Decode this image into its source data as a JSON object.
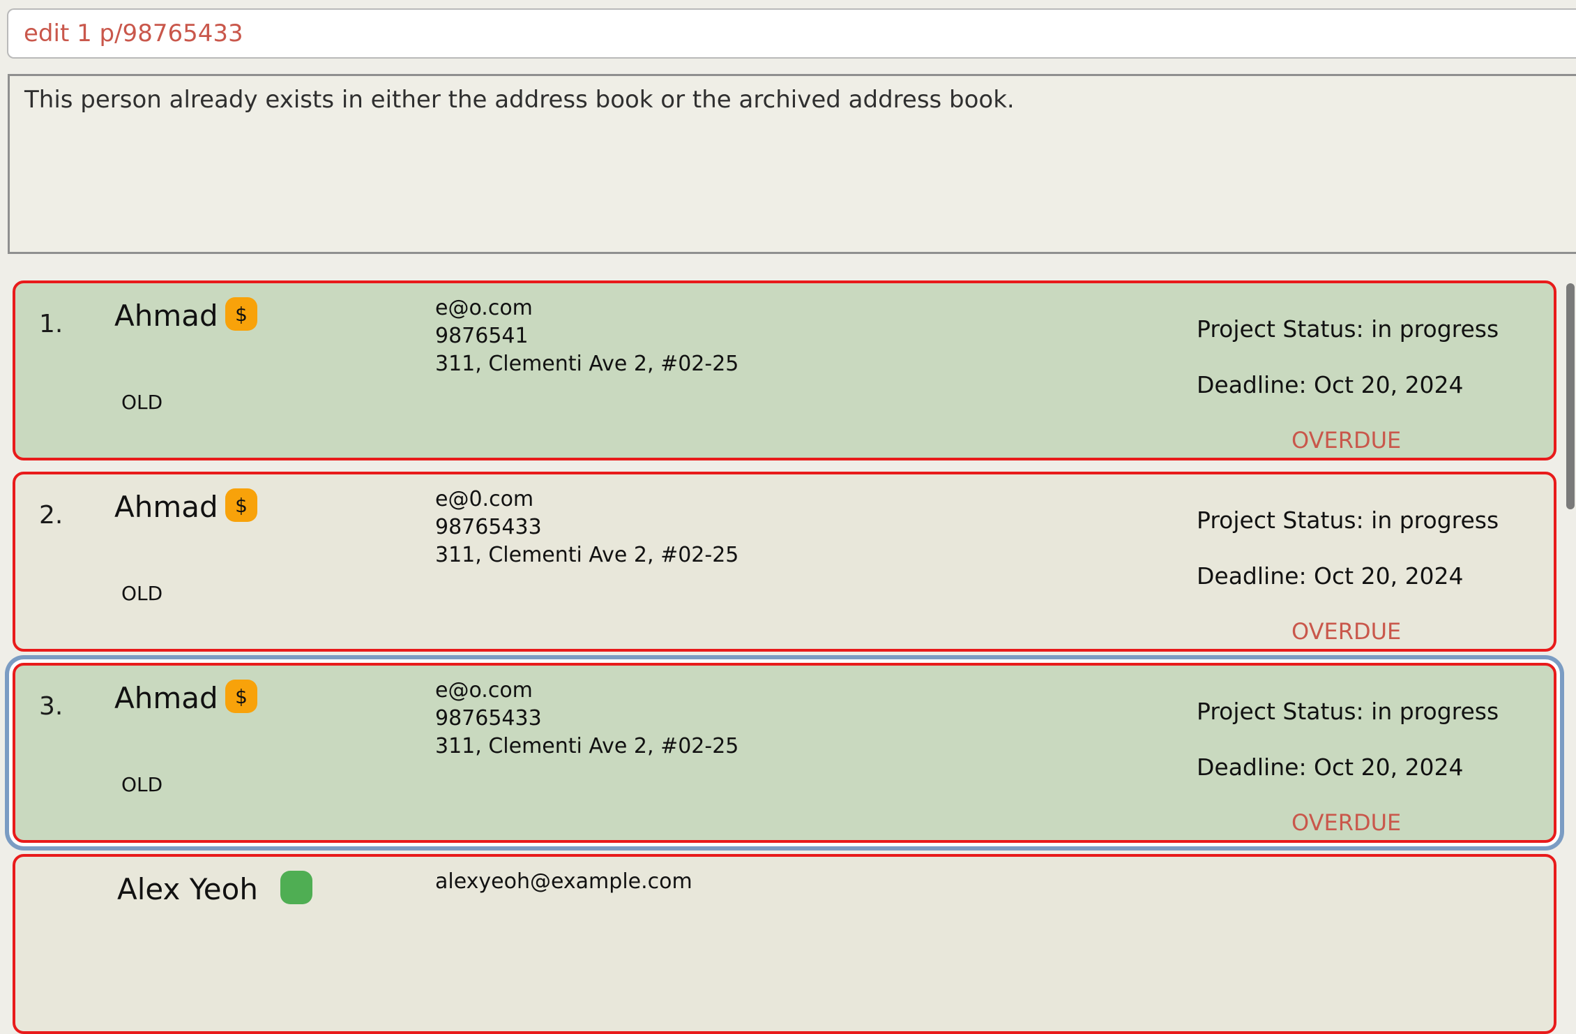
{
  "command": {
    "value": "edit 1 p/98765433"
  },
  "result": {
    "message": "This person already exists in either the address book or the archived address book."
  },
  "persons": [
    {
      "index": "1.",
      "name": "Ahmad",
      "tag": "$",
      "label": "OLD",
      "email": "e@o.com",
      "phone": "9876541",
      "address": "311, Clementi Ave 2, #02-25",
      "status": "Project Status: in progress",
      "deadline": "Deadline: Oct 20, 2024",
      "overdue": "OVERDUE"
    },
    {
      "index": "2.",
      "name": "Ahmad",
      "tag": "$",
      "label": "OLD",
      "email": "e@0.com",
      "phone": "98765433",
      "address": "311, Clementi Ave 2, #02-25",
      "status": "Project Status: in progress",
      "deadline": "Deadline: Oct 20, 2024",
      "overdue": "OVERDUE"
    },
    {
      "index": "3.",
      "name": "Ahmad",
      "tag": "$",
      "label": "OLD",
      "email": "e@o.com",
      "phone": "98765433",
      "address": "311, Clementi Ave 2, #02-25",
      "status": "Project Status: in progress",
      "deadline": "Deadline: Oct 20, 2024",
      "overdue": "OVERDUE"
    },
    {
      "index": "",
      "name": "Alex Yeoh",
      "tag": "",
      "label": "",
      "email": "alexyeoh@example.com",
      "phone": "",
      "address": "",
      "status": "",
      "deadline": "",
      "overdue": ""
    }
  ],
  "colors": {
    "card_green": "#c9d9bf",
    "card_beige": "#e8e7da",
    "card_border": "#e81b1b",
    "selected_outline": "#7b9cc3",
    "tag_orange": "#f8a20a",
    "tag_green": "#4fae53",
    "overdue_text": "#c9574b"
  }
}
